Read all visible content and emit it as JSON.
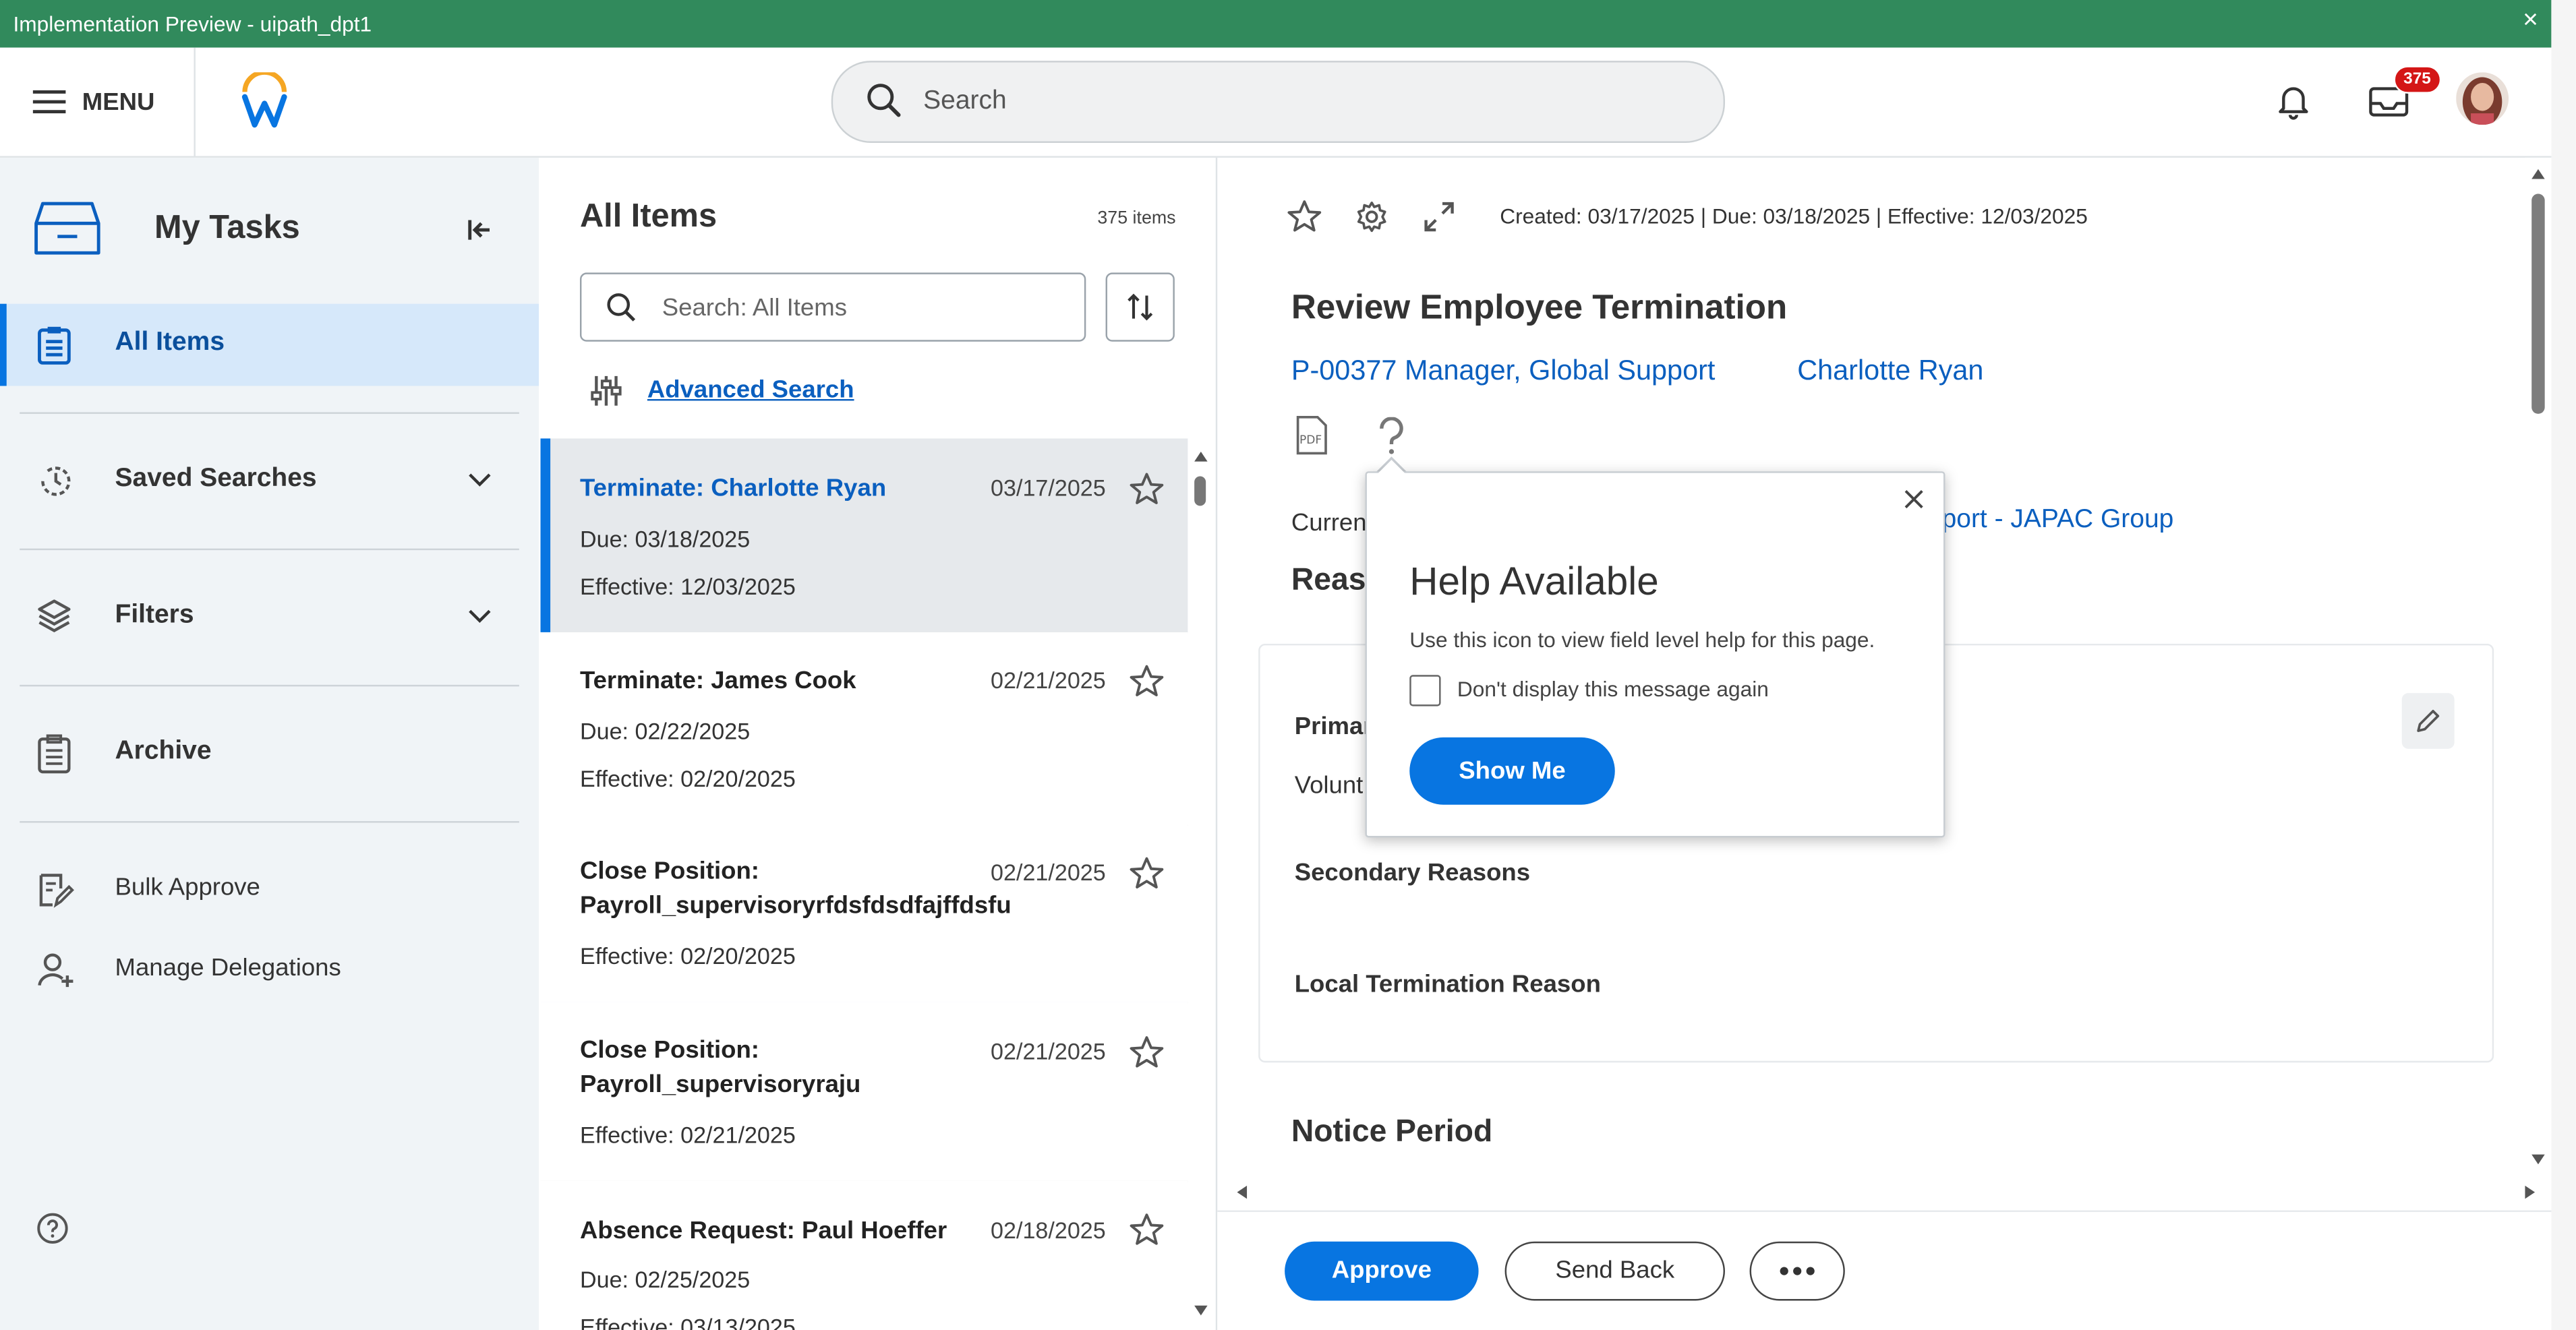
{
  "window": {
    "title": "Implementation Preview - uipath_dpt1",
    "close": "×"
  },
  "header": {
    "menu_label": "MENU",
    "search_placeholder": "Search",
    "inbox_badge": "375"
  },
  "sidebar": {
    "title": "My Tasks",
    "items": [
      {
        "label": "All Items"
      },
      {
        "label": "Saved Searches"
      },
      {
        "label": "Filters"
      },
      {
        "label": "Archive"
      },
      {
        "label": "Bulk Approve"
      },
      {
        "label": "Manage Delegations"
      }
    ]
  },
  "list": {
    "title": "All Items",
    "count": "375 items",
    "search_placeholder": "Search: All Items",
    "advanced_search": "Advanced Search",
    "tasks": [
      {
        "title": "Terminate: Charlotte Ryan",
        "date": "03/17/2025",
        "line1": "Due: 03/18/2025",
        "line2": "Effective: 12/03/2025"
      },
      {
        "title": "Terminate: James Cook",
        "date": "02/21/2025",
        "line1": "Due: 02/22/2025",
        "line2": "Effective: 02/20/2025"
      },
      {
        "title": "Close Position: Payroll_supervisoryrfdsfdsdfajffdsfu",
        "date": "02/21/2025",
        "line1": "Effective: 02/20/2025"
      },
      {
        "title": "Close Position: Payroll_supervisoryraju",
        "date": "02/21/2025",
        "line1": "Effective: 02/21/2025"
      },
      {
        "title": "Absence Request: Paul Hoeffer",
        "date": "02/18/2025",
        "line1": "Due: 02/25/2025",
        "line2": "Effective: 03/13/2025"
      }
    ]
  },
  "detail": {
    "created_line": "Created: 03/17/2025 | Due: 03/18/2025 | Effective: 12/03/2025",
    "title": "Review Employee Termination",
    "position_link": "P-00377 Manager, Global Support",
    "worker_link": "Charlotte Ryan",
    "current_label": "Current",
    "current_value": "port - JAPAC Group",
    "reason_section": "Reaso",
    "primary_label": "Primar",
    "primary_value": "Volunt",
    "secondary_label": "Secondary Reasons",
    "local_label": "Local Termination Reason",
    "notice_section": "Notice Period"
  },
  "popup": {
    "title": "Help Available",
    "description": "Use this icon to view field level help for this page.",
    "checkbox_label": "Don't display this message again",
    "show_me": "Show Me"
  },
  "actions": {
    "approve": "Approve",
    "send_back": "Send Back"
  },
  "colors": {
    "accent": "#0875e1",
    "titlebar": "#318a5c",
    "badge": "#d41616",
    "link": "#0b5fbf"
  }
}
